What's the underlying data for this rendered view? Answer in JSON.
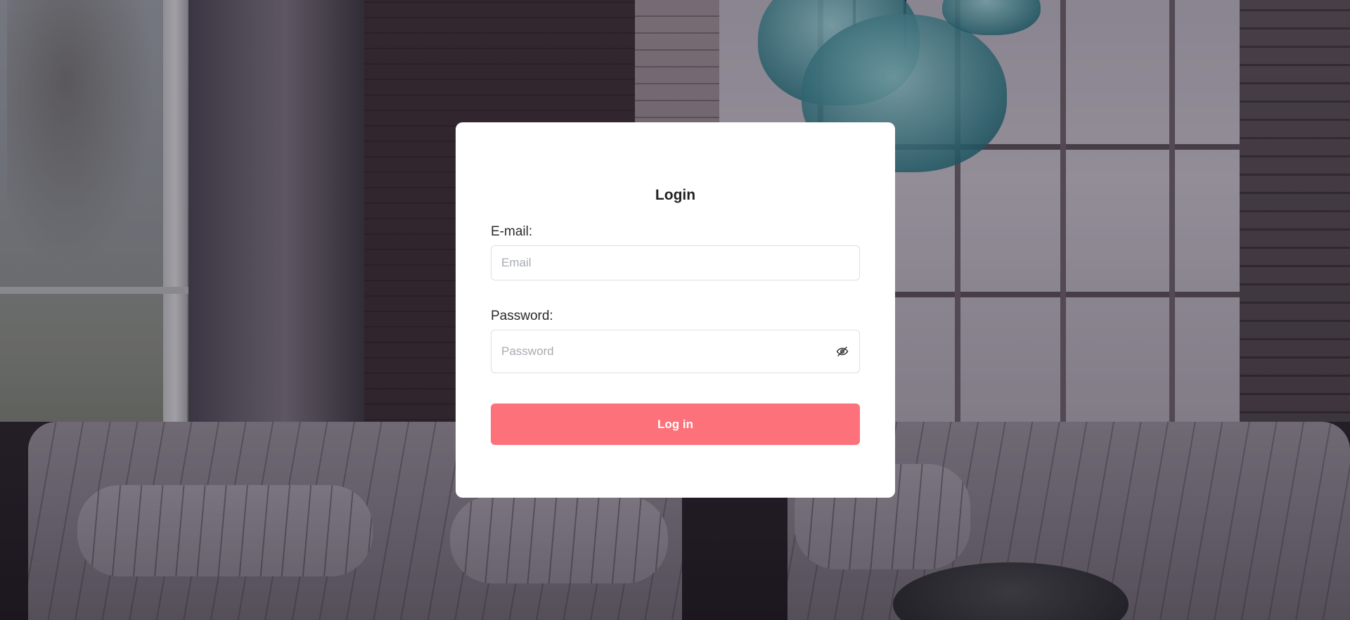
{
  "login_form": {
    "title": "Login",
    "email": {
      "label": "E-mail",
      "label_suffix": ":",
      "value": "",
      "placeholder": "Email"
    },
    "password": {
      "label": "Password",
      "label_suffix": ":",
      "value": "",
      "placeholder": "Password",
      "toggle_icon": "eye-slash-icon"
    },
    "submit_label": "Log in"
  },
  "colors": {
    "card_background": "#ffffff",
    "button_background": "#fd727a",
    "button_text": "#ffffff",
    "input_border": "#dcdfe6",
    "placeholder": "#a8abb2"
  }
}
